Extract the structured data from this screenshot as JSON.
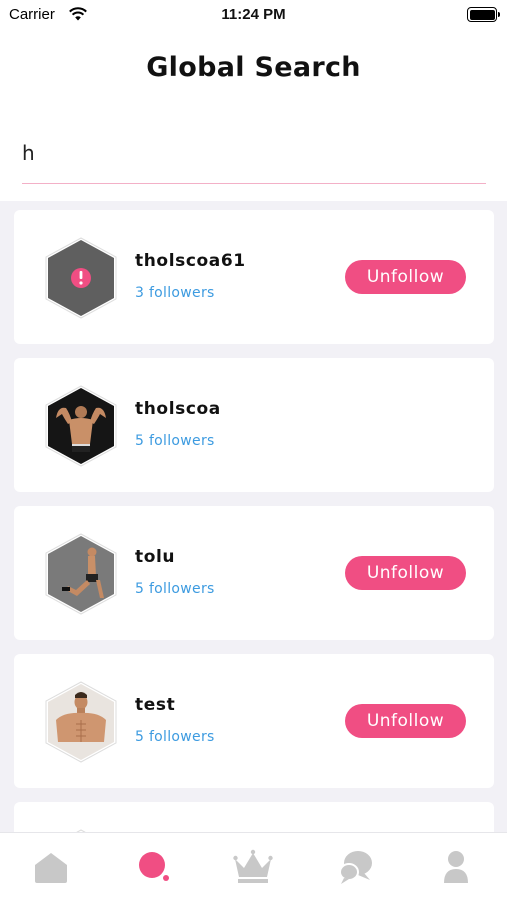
{
  "status": {
    "carrier": "Carrier",
    "time": "11:24 PM"
  },
  "title": "Global Search",
  "search": {
    "value": "h",
    "placeholder": ""
  },
  "results": [
    {
      "username": "tholscoa61",
      "followers": "3 followers",
      "action": "Unfollow"
    },
    {
      "username": "tholscoa",
      "followers": "5 followers",
      "action": ""
    },
    {
      "username": "tolu",
      "followers": "5 followers",
      "action": "Unfollow"
    },
    {
      "username": "test",
      "followers": "5 followers",
      "action": "Unfollow"
    }
  ],
  "tabs": [
    {
      "icon": "home-icon",
      "active": false
    },
    {
      "icon": "search-icon",
      "active": true
    },
    {
      "icon": "crown-icon",
      "active": false
    },
    {
      "icon": "chat-icon",
      "active": false
    },
    {
      "icon": "profile-icon",
      "active": false
    }
  ],
  "colors": {
    "accent": "#f04e83",
    "link": "#3d9be0",
    "inactive_tab": "#c8c8c8",
    "background": "#f2f1f6"
  }
}
